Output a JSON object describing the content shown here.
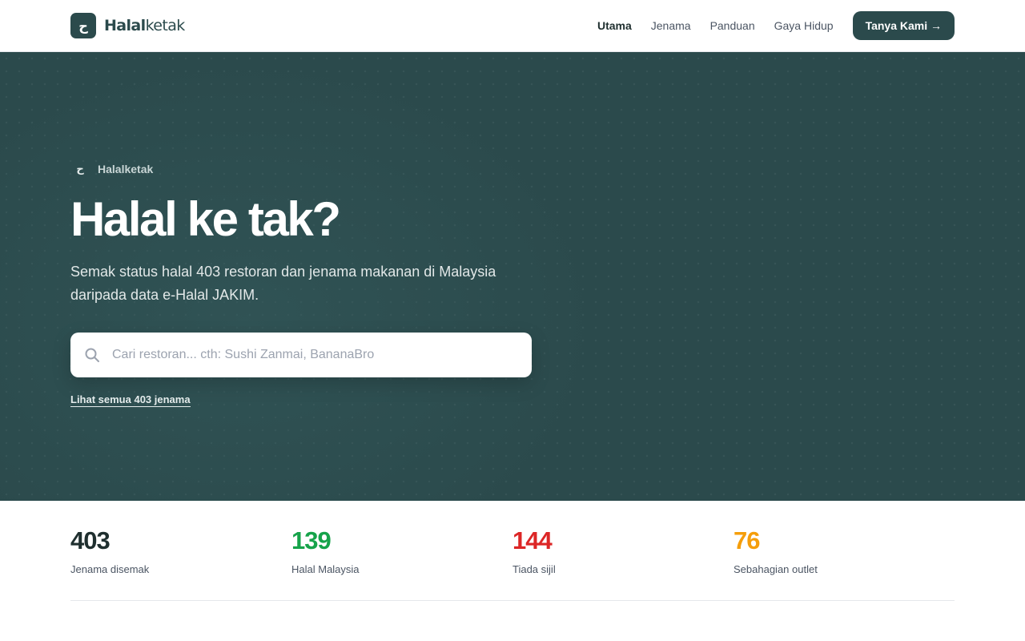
{
  "brand": {
    "logo_glyph": "ح",
    "name_bold": "Halal",
    "name_light": "ketak"
  },
  "nav": {
    "items": [
      {
        "label": "Utama",
        "active": true
      },
      {
        "label": "Jenama",
        "active": false
      },
      {
        "label": "Panduan",
        "active": false
      },
      {
        "label": "Gaya Hidup",
        "active": false
      }
    ],
    "cta_label": "Tanya Kami →"
  },
  "hero": {
    "kicker_icon": "ح",
    "kicker": "Halalketak",
    "title": "Halal ke tak?",
    "description": "Semak status halal 403 restoran dan jenama makanan di Malaysia daripada data e-Halal JAKIM.",
    "search": {
      "placeholder": "Cari restoran... cth: Sushi Zanmai, BananaBro",
      "value": "",
      "icon": "search-icon"
    },
    "view_all": "Lihat semua 403 jenama"
  },
  "stats": [
    {
      "value": "403",
      "label": "Jenama disemak",
      "color": "#1f2f2f"
    },
    {
      "value": "139",
      "label": "Halal Malaysia",
      "color": "#16a34a"
    },
    {
      "value": "144",
      "label": "Tiada sijil",
      "color": "#dc2626"
    },
    {
      "value": "76",
      "label": "Sebahagian outlet",
      "color": "#f59e0b"
    }
  ],
  "colors": {
    "primary": "#2b4a4c",
    "halal": "#16a34a",
    "not_certified": "#dc2626",
    "partial": "#f59e0b"
  }
}
